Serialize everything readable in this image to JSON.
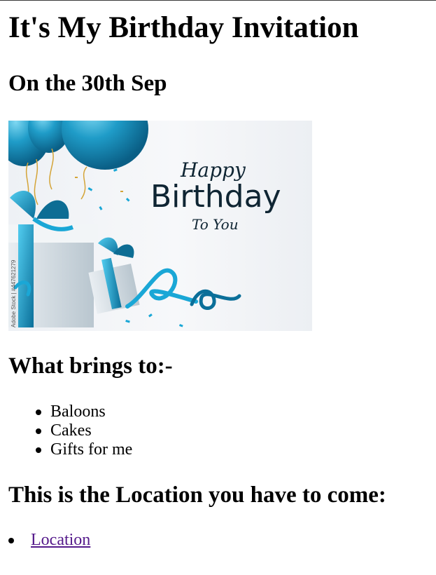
{
  "page": {
    "title": "It's My Birthday Invitation",
    "date_heading": "On the 30th Sep",
    "banner": {
      "line1": "Happy",
      "line2": "Birthday",
      "line3": "To You",
      "watermark": "Adobe Stock | #447621279",
      "accent": "#1aa7d6",
      "text_color": "#0f2533"
    },
    "brings_heading": "What brings to:-",
    "items": [
      "Baloons",
      "Cakes",
      "Gifts for me"
    ],
    "location_heading": "This is the Location you have to come:",
    "location_link": "Location",
    "link_color": "#551a8b"
  }
}
